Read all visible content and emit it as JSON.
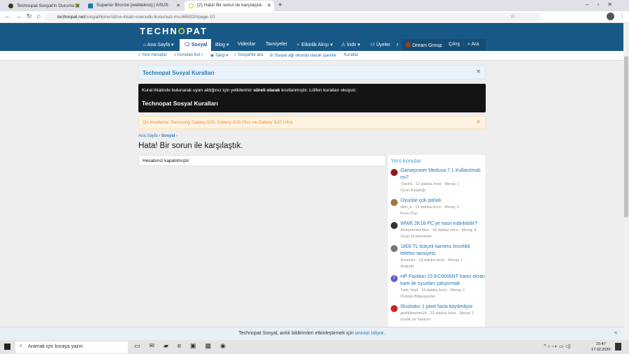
{
  "browser": {
    "tabs": [
      {
        "title": "Technopat Sosyal'in Durumu😭"
      },
      {
        "title": "Superior Bronze [webtekno] | ASUS"
      },
      {
        "title": "(2) Hata! Bir sorun ile karşılaştık."
      }
    ],
    "url_domain": "technopat.net",
    "url_path": "/sosyal/konu/sizce-insan-vuecudu-kusursuz-mu.665920/page-10"
  },
  "header": {
    "logo": "TECHNOPAT",
    "nav": [
      "Ana Sayfa",
      "Sosyal",
      "Blog",
      "Videolar",
      "Tavsiyeler",
      "Etkinlik Akışı",
      "İndir",
      "Üyeler",
      "Dream Group",
      "Çıkış",
      "Ara"
    ]
  },
  "subnav": [
    "Yeni mesajlar",
    "Konuları bul",
    "Takip",
    "Sosyal'de ara",
    "Sosyal ağı okundu olarak işaretle",
    "Kurallar"
  ],
  "notices": {
    "rules_title": "Technopat Sosyal Kuralları",
    "warn_pre": "Kural ihlalinde bulunarak uyarı aldığınız için yetkileriniz ",
    "warn_bold": "süreli olarak",
    "warn_post": " kısıtlanmıştır. Lütfen kuralları okuyun:",
    "warn_title": "Technopat Sosyal Kuralları",
    "review": "Ön İnceleme: Samsung Galaxy S20, Galaxy S20 Plus ve Galaxy S20 Ultra"
  },
  "breadcrumb": [
    "Ana Sayfa",
    "Sosyal"
  ],
  "page_title": "Hata! Bir sorun ile karşılaştık.",
  "error_message": "Hesabınız kapatılmıştır.",
  "sidebar": {
    "title": "Yeni konular",
    "items": [
      {
        "title": "Gamepower Medusa 7.1 Kullanılmalı mı?",
        "meta": "-DarkS · 11 dakika önce · Mesaj: 1",
        "forum": "Oyun Kulaklığı",
        "color": "#8b1a1a"
      },
      {
        "title": "Oyunlar çok pahalı",
        "meta": "ekin_a · 13 dakika önce · Mesaj: 1",
        "forum": "Konu Dışı",
        "color": "#a0743a"
      },
      {
        "title": "WWE 2K16 PC'ye nasıl indirilebilir?",
        "meta": "Muhammed Alim · 15 dakika önce · Mesaj: 4",
        "forum": "Oyun İncelemeleri",
        "color": "#333"
      },
      {
        "title": "1800 TL bütçeli kamera öncelikli telefon tavsiyesi",
        "meta": "Anumsln · 18 dakika önce · Mesaj: 1",
        "forum": "Android",
        "color": "#777"
      },
      {
        "title": "HP Pavilion 15-EC0005NT harici ekran kartı ile oyunları çalıştırmak",
        "meta": "Tarık Yeşil · 19 dakika önce · Mesaj: 1",
        "forum": "Dizüstü Bilgisayarlar",
        "color": "#5c5cd6",
        "letter": "T"
      },
      {
        "title": "Illustrator 1 pixel fazla kaydediyor",
        "meta": "grafikibrahim24 · 23 dakika önce · Mesaj: 1",
        "forum": "Grafik ve Tasarım",
        "color": "#c62828"
      }
    ]
  },
  "notification": {
    "text": "Technopat Sosyal, anlık bildirimleri etkinleştirmek için ",
    "link": "izninizi istiyor",
    "end": "."
  },
  "taskbar": {
    "search_placeholder": "Aramak için buraya yazın",
    "time": "15:47",
    "date": "17.02.2020"
  }
}
